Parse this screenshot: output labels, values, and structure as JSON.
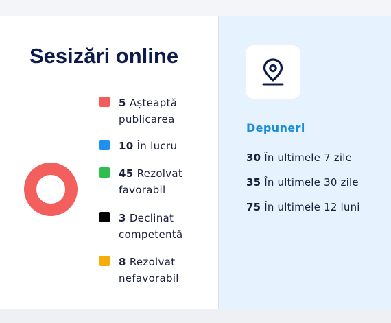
{
  "title": "Sesizări online",
  "legend": [
    {
      "count": "5",
      "label": "Așteaptă publicarea",
      "line1": "Așteaptă",
      "line2": "publicarea",
      "color": "#f45b5b"
    },
    {
      "count": "10",
      "label": "În lucru",
      "line1": "În lucru",
      "line2": "",
      "color": "#1e90f0"
    },
    {
      "count": "45",
      "label": "Rezolvat favorabil",
      "line1": "Rezolvat",
      "line2": "favorabil",
      "color": "#2ebd4e"
    },
    {
      "count": "3",
      "label": "Declinat competentă",
      "line1": "Declinat",
      "line2": "competentă",
      "color": "#000000"
    },
    {
      "count": "8",
      "label": "Rezolvat nefavorabil",
      "line1": "Rezolvat",
      "line2": "nefavorabil",
      "color": "#f5ad0a"
    }
  ],
  "donut": {
    "color": "#f25f5c",
    "icon": "donut-chart"
  },
  "location_icon": "map-pin-icon",
  "depuneri": {
    "title": "Depuneri",
    "stats": [
      {
        "count": "30",
        "label": "În ultimele 7 zile"
      },
      {
        "count": "35",
        "label": "În ultimele 30 zile"
      },
      {
        "count": "75",
        "label": "În ultimele 12 luni"
      }
    ]
  }
}
